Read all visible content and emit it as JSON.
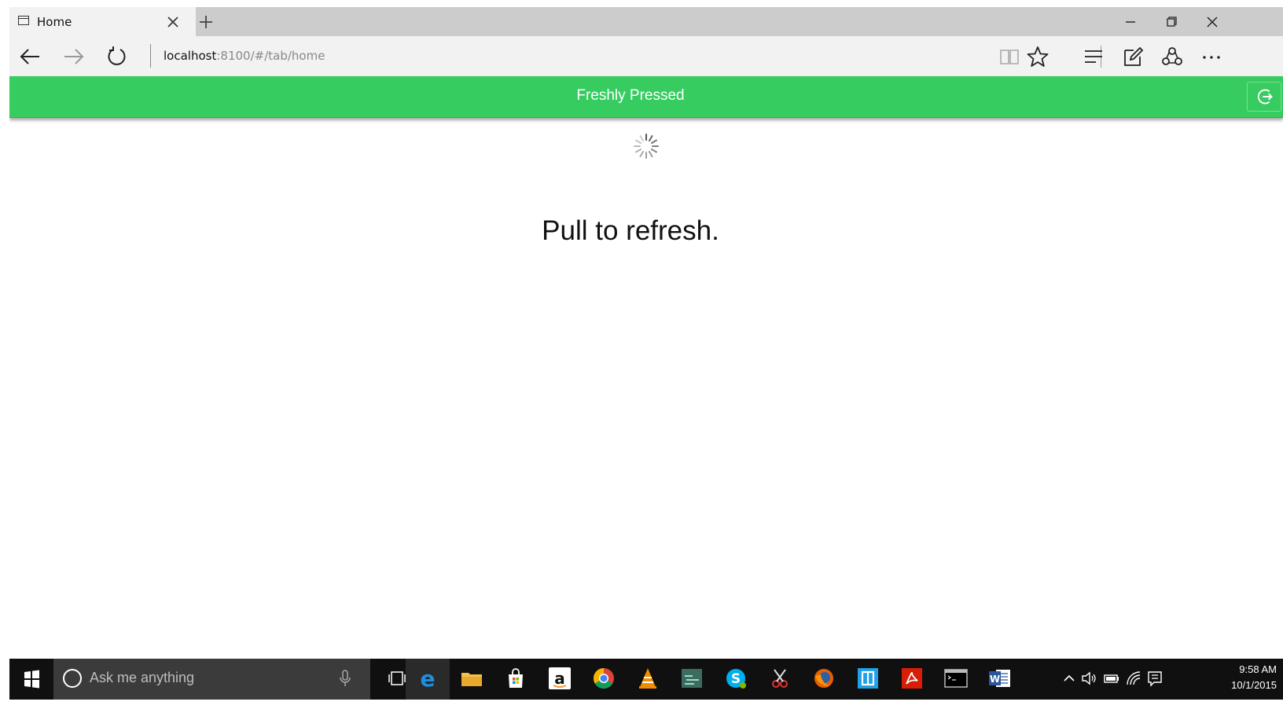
{
  "browser": {
    "tab": {
      "title": "Home"
    },
    "url": {
      "host": "localhost",
      "rest": ":8100/#/tab/home"
    },
    "window_controls": [
      "minimize",
      "restore",
      "close"
    ]
  },
  "app": {
    "header": {
      "title": "Freshly Pressed",
      "accent_color": "#36cc60"
    },
    "refresher": {
      "text": "Pull to refresh."
    }
  },
  "taskbar": {
    "search_placeholder": "Ask me anything",
    "pinned": [
      "task-view",
      "edge",
      "file-explorer",
      "store",
      "amazon",
      "chrome",
      "vlc",
      "sourcetree",
      "skype",
      "snipping",
      "firefox",
      "app",
      "acrobat",
      "cmd",
      "word"
    ],
    "clock": {
      "time": "9:58 AM",
      "date": "10/1/2015"
    }
  }
}
